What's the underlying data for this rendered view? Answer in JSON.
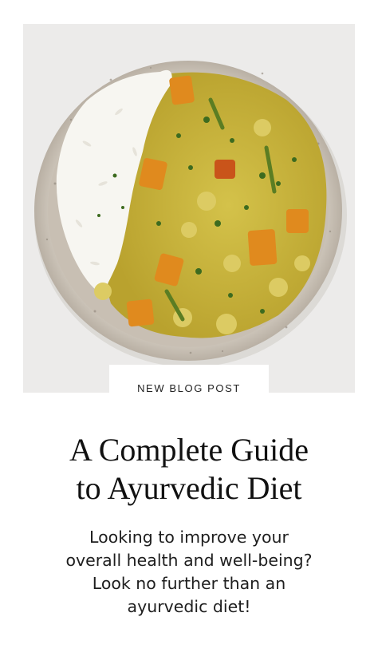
{
  "photo": {
    "icon": "curry-and-rice-bowl",
    "colors": {
      "background": "#ecebea",
      "bowl": "#cfc7bc",
      "curry": "#c9b43a",
      "squash": "#e08a1e",
      "rice": "#f7f6f1",
      "herbs": "#3d6b1f"
    }
  },
  "badge": {
    "label": "NEW BLOG POST"
  },
  "title": {
    "line1": "A Complete Guide",
    "line2": "to Ayurvedic Diet"
  },
  "subtitle": {
    "line1": "Looking to improve your",
    "line2": "overall health and well-being?",
    "line3": "Look no further than an",
    "line4": "ayurvedic diet!"
  }
}
